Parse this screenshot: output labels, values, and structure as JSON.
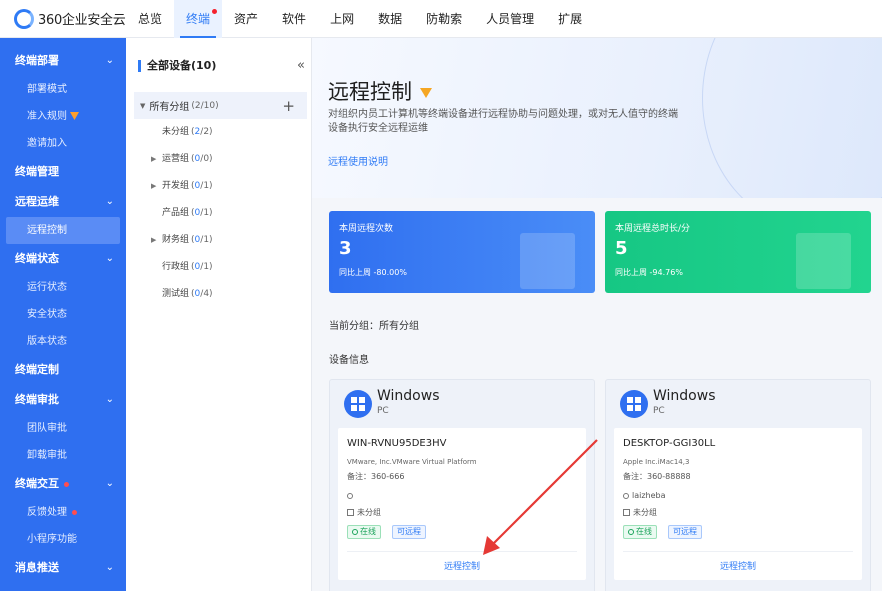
{
  "brand": {
    "name": "360企业安全云"
  },
  "topnav": {
    "items": [
      "总览",
      "终端",
      "资产",
      "软件",
      "上网",
      "数据",
      "防勒索",
      "人员管理",
      "扩展"
    ],
    "active_index": 1
  },
  "sidebar": {
    "groups": [
      {
        "label": "终端部署",
        "expanded": true,
        "items": [
          {
            "label": "部署模式"
          },
          {
            "label": "准入规则",
            "badge": "vip"
          },
          {
            "label": "邀请加入"
          }
        ]
      },
      {
        "label": "终端管理"
      },
      {
        "label": "远程运维",
        "expanded": true,
        "items": [
          {
            "label": "远程控制",
            "active": true
          }
        ]
      },
      {
        "label": "终端状态",
        "expanded": true,
        "items": [
          {
            "label": "运行状态"
          },
          {
            "label": "安全状态"
          },
          {
            "label": "版本状态"
          }
        ]
      },
      {
        "label": "终端定制"
      },
      {
        "label": "终端审批",
        "expanded": true,
        "items": [
          {
            "label": "团队审批"
          },
          {
            "label": "卸载审批"
          }
        ]
      },
      {
        "label": "终端交互",
        "dot": true,
        "expanded": true,
        "items": [
          {
            "label": "反馈处理",
            "dot": true
          },
          {
            "label": "小程序功能"
          }
        ]
      },
      {
        "label": "消息推送"
      }
    ]
  },
  "tree": {
    "title": "全部设备(10)",
    "root": {
      "label": "所有分组",
      "count": "(2/10)"
    },
    "nodes": [
      {
        "label": "未分组",
        "online": "2",
        "total": "2",
        "has_children": false
      },
      {
        "label": "运营组",
        "online": "0",
        "total": "0",
        "has_children": true
      },
      {
        "label": "开发组",
        "online": "0",
        "total": "1",
        "has_children": true
      },
      {
        "label": "产品组",
        "online": "0",
        "total": "1",
        "has_children": false
      },
      {
        "label": "财务组",
        "online": "0",
        "total": "1",
        "has_children": true
      },
      {
        "label": "行政组",
        "online": "0",
        "total": "1",
        "has_children": false
      },
      {
        "label": "测试组",
        "online": "0",
        "total": "4",
        "has_children": false
      }
    ]
  },
  "page": {
    "title": "远程控制",
    "desc": "对组织内员工计算机等终端设备进行远程协助与问题处理，或对无人值守的终端设备执行安全远程运维",
    "help_link": "远程使用说明",
    "current_group_label": "当前分组：",
    "current_group": "所有分组",
    "devices_title": "设备信息"
  },
  "stats": [
    {
      "label": "本周远程次数",
      "value": "3",
      "compare": "同比上周 -80.00%",
      "color": "#2f6ff0"
    },
    {
      "label": "本周远程总时长/分",
      "value": "5",
      "compare": "同比上周 -94.76%",
      "color": "#16c784"
    }
  ],
  "devices": [
    {
      "os": "Windows",
      "type": "PC",
      "hostname": "WIN-RVNU95DE3HV",
      "model": "VMware, Inc.VMware Virtual Platform",
      "note": "备注：360-666",
      "user": "",
      "group": "未分组",
      "status": "在线",
      "remote_tag": "可远程",
      "action": "远程控制"
    },
    {
      "os": "Windows",
      "type": "PC",
      "hostname": "DESKTOP-GGI30LL",
      "model": "Apple Inc.iMac14,3",
      "note": "备注：360-88888",
      "user": "laizheba",
      "group": "未分组",
      "status": "在线",
      "remote_tag": "可远程",
      "action": "远程控制"
    }
  ],
  "annotation": {
    "type": "arrow",
    "color": "#e53935",
    "target": "devices.0.action"
  }
}
